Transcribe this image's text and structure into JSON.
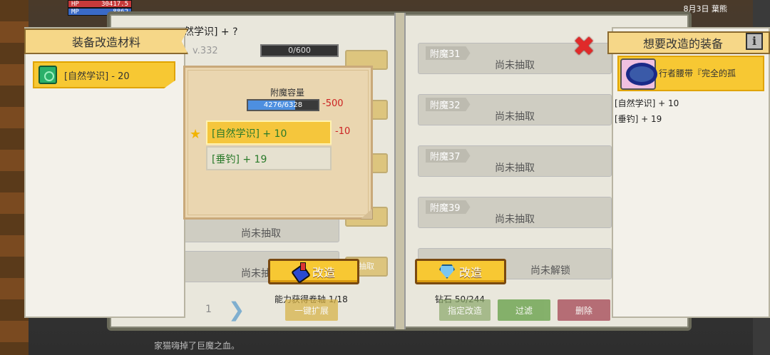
{
  "hud": {
    "hp_label": "HP",
    "hp_value": "30417.5",
    "mp_label": "MP",
    "mp_value": "8862"
  },
  "top_bar": {
    "date": "8月3日",
    "extra": "葉熊"
  },
  "recipe": {
    "title": "然学识] + ?",
    "level": "v.332",
    "progress": "0/600",
    "ghost_button": "指定改"
  },
  "enchant_slots": [
    {
      "label": "附魔31",
      "status": "尚未抽取"
    },
    {
      "label": "附魔32",
      "status": "尚未抽取"
    },
    {
      "label": "附魔37",
      "status": "尚未抽取"
    },
    {
      "label": "附魔39",
      "status": "尚未抽取"
    },
    {
      "label": "",
      "status": "尚未解锁"
    }
  ],
  "left_slots_status": [
    "尚未抽取",
    "尚未抽取"
  ],
  "material_panel": {
    "title": "装备改造材料",
    "items": [
      {
        "label": "[自然学识] - 20",
        "icon": "green-book-icon"
      }
    ]
  },
  "popup": {
    "capacity_label": "附魔容量",
    "capacity_text": "4276/6328",
    "capacity_fraction": 0.6757,
    "capacity_delta": "-500",
    "attributes": [
      {
        "text": "[自然学识] + 10",
        "delta": "-10",
        "selected": true
      },
      {
        "text": "[垂钓] + 19",
        "delta": "",
        "selected": false
      }
    ]
  },
  "equip_panel": {
    "title": "想要改造的装备",
    "item_name": "旅行者腰带『完全的孤",
    "item_name_visible": "行者腰带『完全的孤",
    "stats": [
      "[自然学识] + 10",
      "[垂钓] + 19"
    ]
  },
  "actions": {
    "modify_scroll_label": "改造",
    "scroll_cost": "能力获得卷轴 1/18",
    "modify_gem_label": "改造",
    "gem_cost": "钻石 50/244",
    "expand_label": "一键扩展",
    "assign_label": "指定改造",
    "filter_label": "过滤",
    "delete_label": "删除",
    "draw_label": "抽取"
  },
  "pager": {
    "page": "1"
  },
  "bottom_message": "家猫嗨掉了巨魔之血。",
  "colors": {
    "accent_gold": "#f7c833",
    "red_delta": "#cc2222",
    "stat_green": "#2a7a2a"
  }
}
